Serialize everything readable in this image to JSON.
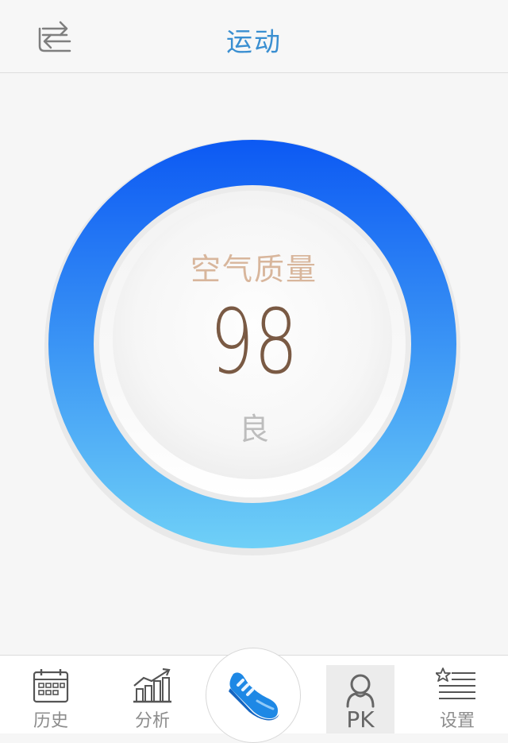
{
  "header": {
    "title": "运动",
    "left_icon": "swap-arrows-icon"
  },
  "air_quality": {
    "label": "空气质量",
    "value": "98",
    "level": "良",
    "gauge_colors": {
      "top": "#0f5ef2",
      "bottom": "#6ccbf7"
    }
  },
  "tabbar": {
    "tabs": [
      {
        "label": "历史",
        "icon": "calendar-icon"
      },
      {
        "label": "分析",
        "icon": "chart-icon"
      },
      {
        "label": "",
        "icon": "shoe-icon"
      },
      {
        "label": "PK",
        "icon": "user-icon"
      },
      {
        "label": "设置",
        "icon": "settings-list-icon"
      }
    ]
  },
  "colors": {
    "title": "#3a8fd1",
    "label": "#d8b69c",
    "value": "#7a5a44"
  }
}
